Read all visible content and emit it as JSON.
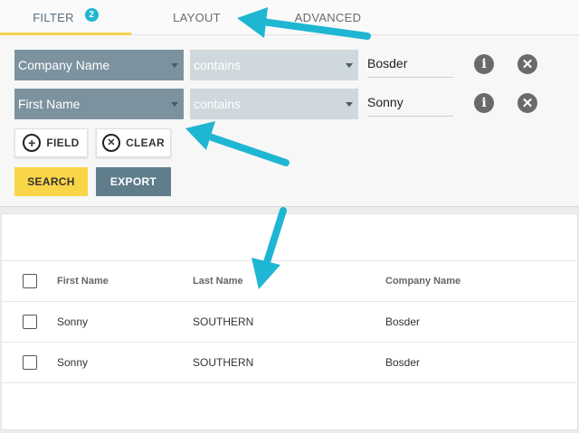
{
  "tabs": {
    "filter": {
      "label": "FILTER",
      "badge": "2"
    },
    "layout": {
      "label": "LAYOUT"
    },
    "advanced": {
      "label": "ADVANCED"
    }
  },
  "filters": [
    {
      "field": "Company Name",
      "operator": "contains",
      "value": "Bosder"
    },
    {
      "field": "First Name",
      "operator": "contains",
      "value": "Sonny"
    }
  ],
  "buttons": {
    "add_field": "FIELD",
    "clear": "CLEAR",
    "search": "SEARCH",
    "export": "EXPORT"
  },
  "icons": {
    "info": "info-icon",
    "remove": "close-circle-icon",
    "add": "plus-circle-icon",
    "clear": "x-circle-icon"
  },
  "table": {
    "columns": [
      "First Name",
      "Last Name",
      "Company Name"
    ],
    "rows": [
      [
        "Sonny",
        "SOUTHERN",
        "Bosder"
      ],
      [
        "Sonny",
        "SOUTHERN",
        "Bosder"
      ]
    ]
  },
  "colors": {
    "accent": "#f9d548",
    "badge": "#1fb6d3",
    "field_select": "#7c939f",
    "export": "#607d8b",
    "annotation_arrow": "#1fb6d3"
  }
}
